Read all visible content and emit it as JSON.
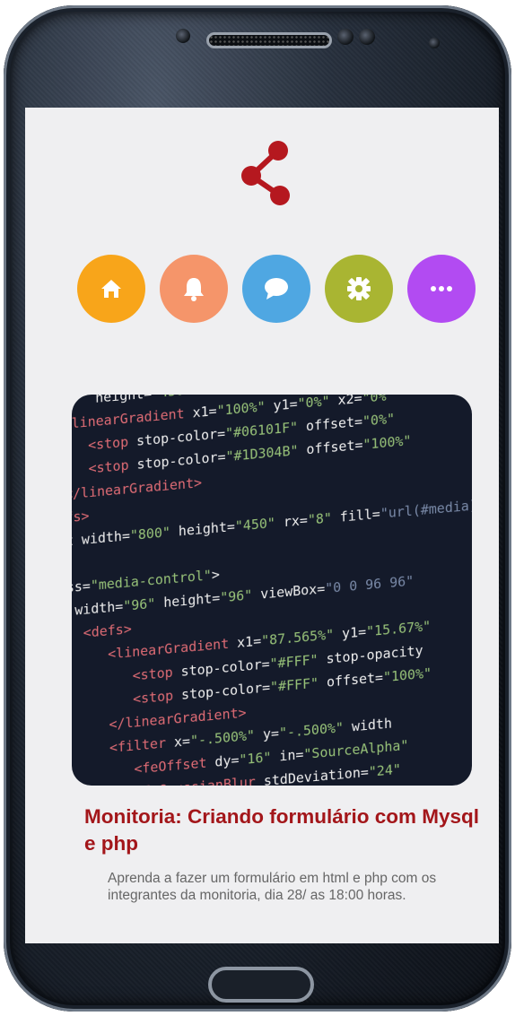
{
  "colors": {
    "accent": "#b5181f",
    "home": "#f8a51a",
    "notifications": "#f5956a",
    "messages": "#4fa7e2",
    "settings": "#a9b532",
    "more": "#b24bf2",
    "screen_bg": "#efeff1"
  },
  "header": {
    "icon": "share-icon"
  },
  "nav_icons": [
    {
      "name": "home-icon",
      "color": "#f8a51a"
    },
    {
      "name": "bell-icon",
      "color": "#f5956a"
    },
    {
      "name": "chat-icon",
      "color": "#4fa7e2"
    },
    {
      "name": "gear-icon",
      "color": "#a9b532"
    },
    {
      "name": "more-icon",
      "color": "#b24bf2"
    }
  ],
  "card": {
    "title": "Monitoria: Criando formulário com Mysql e php",
    "description": "Aprenda a fazer um formulário em html e php com os integrantes da monitoria, dia 28/ as 18:00 horas."
  }
}
